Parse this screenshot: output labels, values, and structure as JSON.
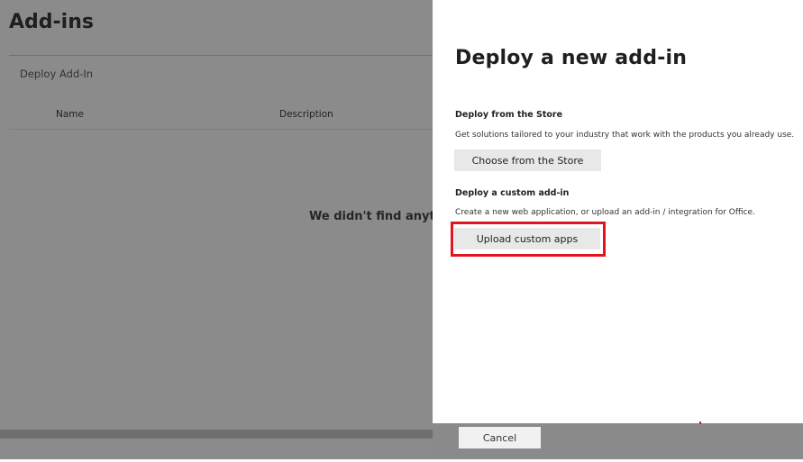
{
  "background_page": {
    "title": "Add-ins",
    "deploy_button": "Deploy Add-In",
    "columns": [
      "Name",
      "Description"
    ],
    "empty_message": "We didn't find anything"
  },
  "panel": {
    "title": "Deploy a new add-in",
    "store_section": {
      "heading": "Deploy from the Store",
      "description": "Get solutions tailored to your industry that work with the products you already use.",
      "button": "Choose from the Store"
    },
    "custom_section": {
      "heading": "Deploy a custom add-in",
      "description": "Create a new web application, or upload an add-in / integration for Office.",
      "button": "Upload custom apps"
    },
    "cancel_button": "Cancel"
  },
  "colors": {
    "highlight": "#e3141e",
    "overlay": "#8b8b8b"
  }
}
